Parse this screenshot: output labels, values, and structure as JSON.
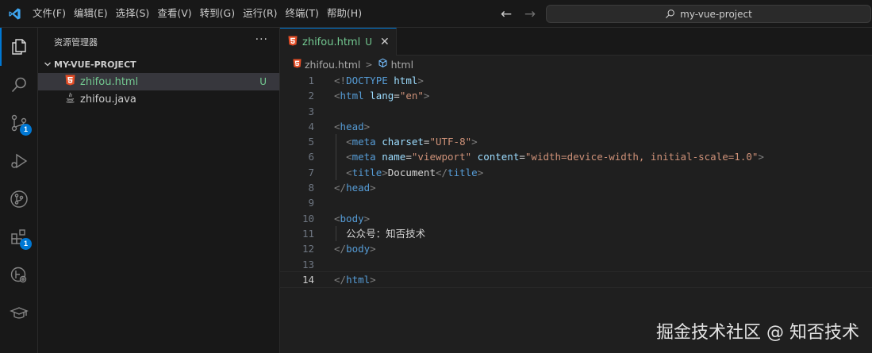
{
  "titlebar": {
    "menus": [
      "文件(F)",
      "编辑(E)",
      "选择(S)",
      "查看(V)",
      "转到(G)",
      "运行(R)",
      "终端(T)",
      "帮助(H)"
    ],
    "search_text": "my-vue-project"
  },
  "activitybar": {
    "items": [
      {
        "icon": "explorer-icon",
        "active": true
      },
      {
        "icon": "search-icon"
      },
      {
        "icon": "source-control-icon",
        "badge": "1"
      },
      {
        "icon": "run-debug-icon"
      },
      {
        "icon": "git-graph-icon"
      },
      {
        "icon": "extensions-icon",
        "badge": "1"
      },
      {
        "icon": "remote-explorer-icon"
      },
      {
        "icon": "learn-icon"
      }
    ],
    "badges": {
      "source_control": "1",
      "extensions": "1"
    }
  },
  "sidebar": {
    "title": "资源管理器",
    "more": "···",
    "folder": "MY-VUE-PROJECT",
    "files": [
      {
        "name": "zhifou.html",
        "status": "U",
        "selected": true
      },
      {
        "name": "zhifou.java",
        "status": "",
        "selected": false
      }
    ]
  },
  "editor": {
    "tab": {
      "label": "zhifou.html",
      "status": "U"
    },
    "breadcrumb": {
      "file": "zhifou.html",
      "symbol": "html"
    },
    "current_line": 14
  },
  "watermark": "掘金技术社区 @ 知否技术",
  "colors": {
    "accent": "#0078d4",
    "untracked": "#73c991",
    "tag": "#569cd6",
    "attr": "#9cdcfe",
    "string": "#ce9178"
  }
}
